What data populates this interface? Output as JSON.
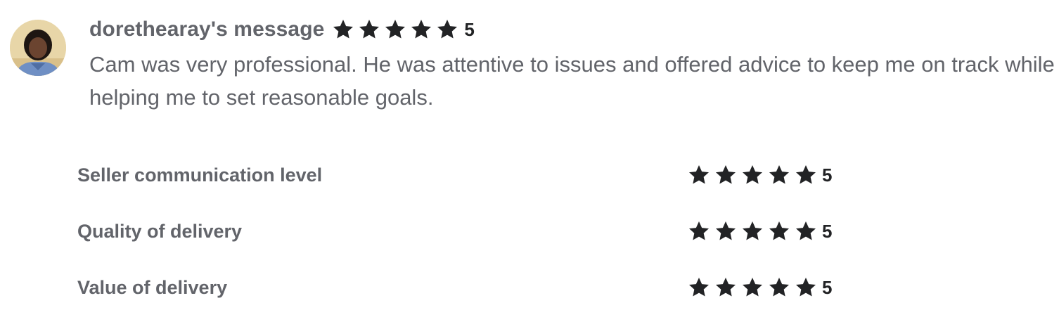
{
  "review": {
    "username": "dorethearay's message",
    "rating": "5",
    "rating_value": 5,
    "text": "Cam was very professional. He was attentive to issues and offered advice to keep me on track while helping me to set reasonable goals."
  },
  "breakdown": [
    {
      "label": "Seller communication level",
      "rating": "5",
      "rating_value": 5
    },
    {
      "label": "Quality of delivery",
      "rating": "5",
      "rating_value": 5
    },
    {
      "label": "Value of delivery",
      "rating": "5",
      "rating_value": 5
    }
  ],
  "colors": {
    "star": "#222325",
    "text": "#62646a"
  }
}
